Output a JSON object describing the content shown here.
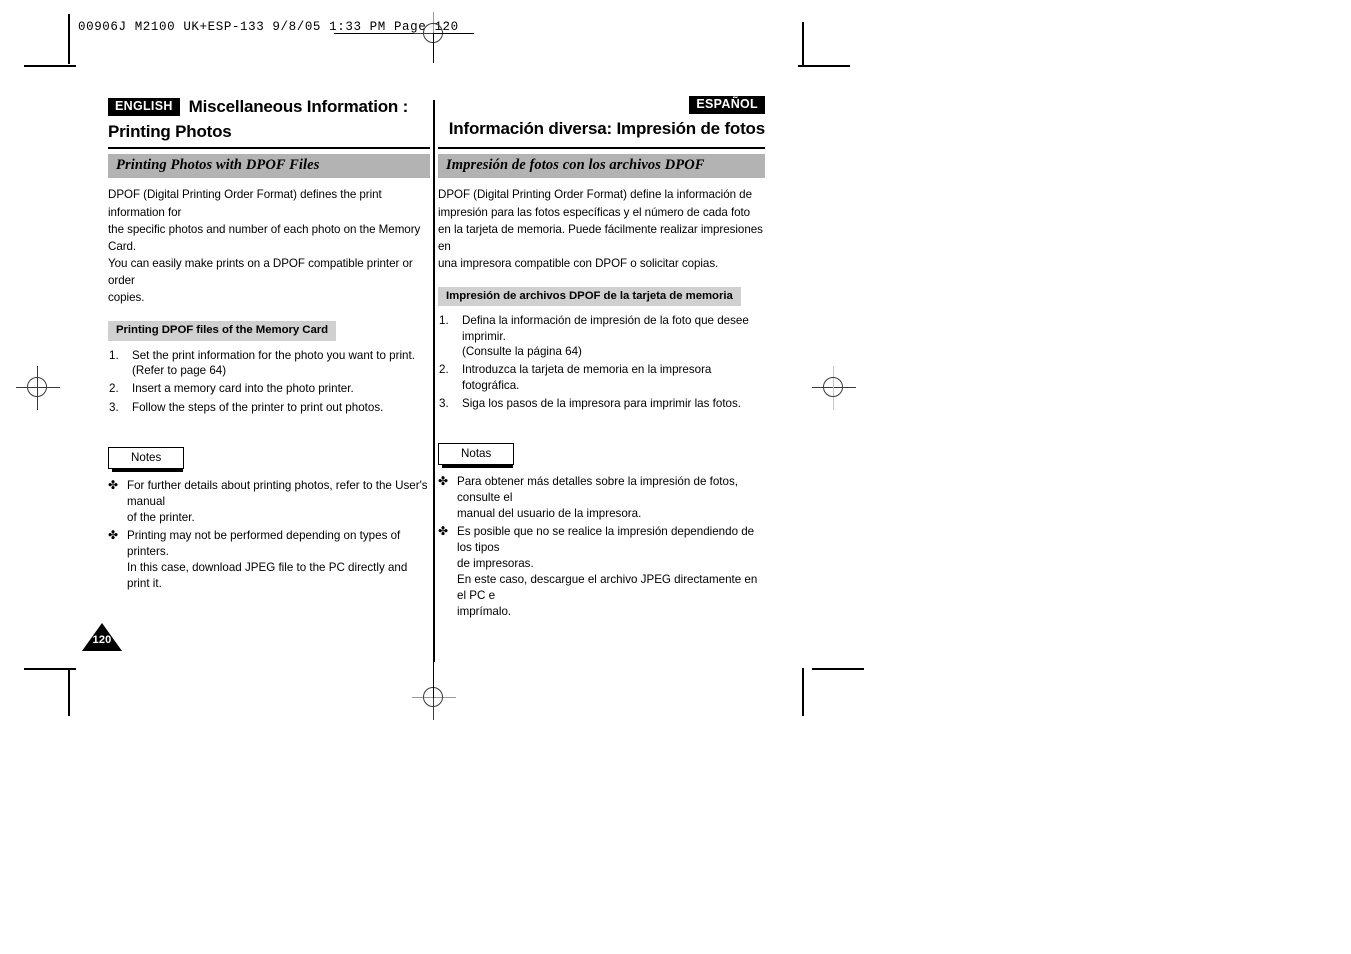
{
  "print_slug": "00906J  M2100 UK+ESP-133   9/8/05 1:33 PM   Page 120",
  "page_number": "120",
  "english": {
    "lang_tag": "ENGLISH",
    "title_line1": "Miscellaneous Information :",
    "title_line2": "Printing Photos",
    "section_bar": "Printing Photos with DPOF Files",
    "intro": [
      "DPOF (Digital Printing Order Format) defines the print information for",
      "the specific photos and number of each photo on the Memory Card.",
      "You can easily make prints on a DPOF compatible printer or order",
      "copies."
    ],
    "sub_bar": "Printing DPOF files of the Memory Card",
    "steps": [
      {
        "num": "1.",
        "text": "Set the print information for the photo you want to print.",
        "sub": "(Refer to page 64)"
      },
      {
        "num": "2.",
        "text": "Insert a memory card into the photo printer.",
        "sub": ""
      },
      {
        "num": "3.",
        "text": "Follow the steps of the printer to print out photos.",
        "sub": ""
      }
    ],
    "notes_label": "Notes",
    "notes": [
      {
        "text": "For further details about printing photos, refer to the User's manual",
        "sub": "of the printer.",
        "sub2": ""
      },
      {
        "text": "Printing may not be performed depending on types of printers.",
        "sub": "In this case, download JPEG file to the PC directly and print it.",
        "sub2": ""
      }
    ]
  },
  "spanish": {
    "lang_tag": "ESPAÑOL",
    "title_main": "Información diversa: Impresión de fotos",
    "section_bar": "Impresión de fotos con los archivos DPOF",
    "intro": [
      "DPOF (Digital Printing Order Format) define la información de",
      "impresión para las fotos específicas y el número de cada foto",
      "en la tarjeta de memoria. Puede fácilmente realizar impresiones en",
      "una impresora compatible con DPOF o solicitar copias."
    ],
    "sub_bar": "Impresión de archivos DPOF de la tarjeta de memoria",
    "steps": [
      {
        "num": "1.",
        "text": "Defina la información de impresión de la foto que desee imprimir.",
        "sub": "(Consulte la página 64)"
      },
      {
        "num": "2.",
        "text": "Introduzca la tarjeta de memoria en la impresora fotográfica.",
        "sub": ""
      },
      {
        "num": "3.",
        "text": "Siga los pasos de la impresora para imprimir las fotos.",
        "sub": ""
      }
    ],
    "notes_label": "Notas",
    "notes": [
      {
        "text": "Para obtener más detalles sobre la impresión de fotos, consulte el",
        "sub": "manual del usuario de la impresora.",
        "sub2": ""
      },
      {
        "text": "Es posible que no se realice la impresión dependiendo de los tipos",
        "sub": "de impresoras.",
        "sub2": "En este caso, descargue el archivo JPEG directamente en el PC e",
        "sub3": "imprímalo."
      }
    ]
  },
  "bullet_glyph": "✤"
}
